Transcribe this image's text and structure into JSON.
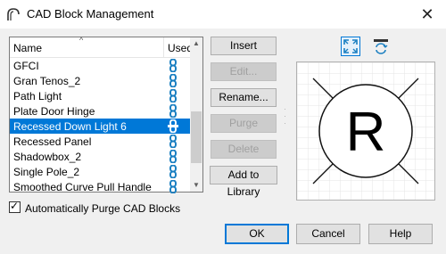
{
  "window": {
    "title": "CAD Block Management",
    "close_glyph": "✕"
  },
  "list": {
    "columns": {
      "name": "Name",
      "used": "Used"
    },
    "sort_indicator": "^",
    "rows": [
      {
        "name": "GFCI",
        "used_icon": "chain-link-icon"
      },
      {
        "name": "Gran Tenos_2",
        "used_icon": "chain-link-icon"
      },
      {
        "name": "Path Light",
        "used_icon": "chain-link-icon"
      },
      {
        "name": "Plate Door Hinge",
        "used_icon": "chain-link-icon"
      },
      {
        "name": "Recessed Down Light 6",
        "used_icon": "chain-link-icon",
        "selected": true
      },
      {
        "name": "Recessed Panel",
        "used_icon": "chain-link-icon"
      },
      {
        "name": "Shadowbox_2",
        "used_icon": "chain-link-icon"
      },
      {
        "name": "Single Pole_2",
        "used_icon": "chain-link-icon"
      },
      {
        "name": "Smoothed Curve Pull Handle",
        "used_icon": "chain-link-icon"
      }
    ]
  },
  "actions": {
    "insert": "Insert",
    "edit": "Edit...",
    "rename": "Rename...",
    "purge": "Purge",
    "delete": "Delete",
    "add_to_library": "Add to Library"
  },
  "preview": {
    "symbol": "R"
  },
  "auto_purge": {
    "label": "Automatically Purge CAD Blocks",
    "checked": true
  },
  "footer": {
    "ok": "OK",
    "cancel": "Cancel",
    "help": "Help"
  },
  "colors": {
    "selection": "#0078d7",
    "link_icon": "#1a7fc1",
    "accent": "#0078d7"
  }
}
